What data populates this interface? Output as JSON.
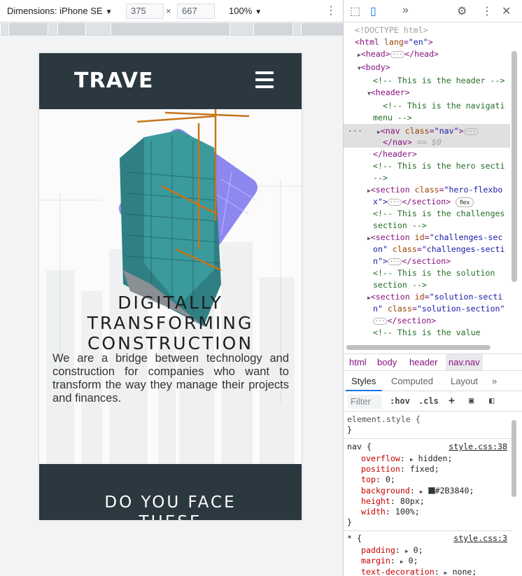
{
  "emulator": {
    "dimensions_label": "Dimensions: iPhone SE",
    "caret": "▼",
    "width_value": "375",
    "height_value": "667",
    "times": "×",
    "zoom_label": "100%",
    "zoom_caret": "▼",
    "more": "⋮"
  },
  "site": {
    "logo": "TRAVE",
    "hero_title_1": "DIGITALLY",
    "hero_title_2": "TRANSFORMING",
    "hero_title_3": "CONSTRUCTION",
    "hero_text": "We are a bridge between technology and construction for companies who want to transform the way they manage their projects and finances.",
    "section2_title_1": "DO YOU FACE",
    "section2_title_2": "THESE"
  },
  "devtools": {
    "top": {
      "inspect": "⬚",
      "device": "▯",
      "more_tabs": "»",
      "settings": "⚙",
      "menu": "⋮",
      "close": "✕"
    },
    "dom": {
      "doctype": "<!DOCTYPE html>",
      "html_open": "<html",
      "html_attr": " lang",
      "html_val": "\"en\"",
      "head": "<head>",
      "head_close": "</head>",
      "body": "<body>",
      "c_header": "<!-- This is the header -->",
      "header": "<header>",
      "c_nav_1": "<!-- This is the navigati",
      "c_nav_2": "menu -->",
      "nav_open": "<nav",
      "nav_attr": " class",
      "nav_val": "\"nav\"",
      "nav_close": "</nav>",
      "eq_sel": " == $0",
      "header_close": "</header>",
      "c_hero_1": "<!-- This is the hero secti",
      "c_hero_2": "-->",
      "sec1_1": "<section",
      "sec1_attr": " class",
      "sec1_val": "\"hero-flexbo",
      "sec1_2": "x\">",
      "sec_close": "</section>",
      "flex_badge": "flex",
      "c_chal_1": "<!-- This is the challenges",
      "c_chal_2": "section -->",
      "sec2_1": "<section",
      "sec2_attr1": " id",
      "sec2_val1": "\"challenges-sec",
      "sec2_2": "on\"",
      "sec2_attr2": " class",
      "sec2_val2": "\"challenges-secti",
      "sec2_3": "n\">",
      "c_sol_1": "<!-- This is the solution",
      "c_sol_2": "section -->",
      "sec3_1": "<section",
      "sec3_attr1": " id",
      "sec3_val1": "\"solution-secti",
      "sec3_2": "n\"",
      "sec3_attr2": " class",
      "sec3_val2": "\"solution-section\"",
      "c_val_1": "<!-- This is the value",
      "ellipsis": "···"
    },
    "breadcrumbs": [
      "html",
      "body",
      "header",
      "nav.nav"
    ],
    "tabs": [
      "Styles",
      "Computed",
      "Layout",
      "»"
    ],
    "filter_placeholder": "Filter",
    "hov": ":hov",
    "cls": ".cls",
    "plus": "+",
    "element_style": "element.style {",
    "close_brace": "}",
    "rule1": {
      "selector": "nav {",
      "source": "style.css:38",
      "props": [
        {
          "name": "overflow",
          "value": "hidden;"
        },
        {
          "name": "position",
          "value": "fixed;"
        },
        {
          "name": "top",
          "value": "0;"
        },
        {
          "name": "background",
          "value": "#2B3840;"
        },
        {
          "name": "height",
          "value": "80px;"
        },
        {
          "name": "width",
          "value": "100%;"
        }
      ]
    },
    "rule2": {
      "selector": "* {",
      "source": "style.css:3",
      "props": [
        {
          "name": "padding",
          "value": "0;"
        },
        {
          "name": "margin",
          "value": "0;"
        },
        {
          "name": "text-decoration",
          "value": "none;"
        }
      ]
    },
    "colors": {
      "nav_bg": "#2B3840",
      "accent": "#1a73e8",
      "tag": "#881280"
    }
  }
}
